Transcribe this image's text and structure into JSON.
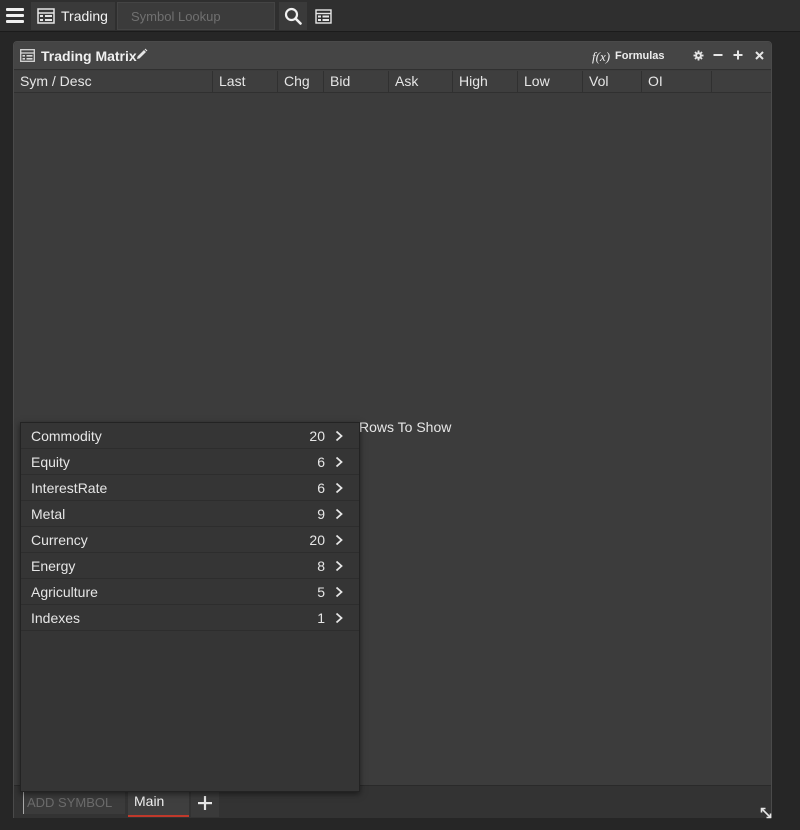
{
  "toolbar": {
    "menu_icon": "hamburger-icon",
    "tab_label": "Trading",
    "tab_icon": "layout-icon",
    "search_placeholder": "Symbol Lookup",
    "search_icon": "search-icon",
    "layout_icon": "layout-icon"
  },
  "panel": {
    "title": "Trading Matrix",
    "title_icon": "layout-icon",
    "edit_icon": "pencil-icon",
    "fx_symbol": "f(x)",
    "formulas_label": "Formulas",
    "controls": [
      "gear-icon",
      "minimize-icon",
      "maximize-icon",
      "close-icon"
    ],
    "columns": [
      "Sym / Desc",
      "Last",
      "Chg",
      "Bid",
      "Ask",
      "High",
      "Low",
      "Vol",
      "OI"
    ],
    "empty_message": "Rows To Show"
  },
  "footer": {
    "add_symbol_placeholder": "ADD SYMBOL",
    "tab_label": "Main",
    "add_tab_icon": "plus-icon",
    "resize_icon": "resize-icon"
  },
  "dropdown": {
    "items": [
      {
        "label": "Commodity",
        "count": "20"
      },
      {
        "label": "Equity",
        "count": "6"
      },
      {
        "label": "InterestRate",
        "count": "6"
      },
      {
        "label": "Metal",
        "count": "9"
      },
      {
        "label": "Currency",
        "count": "20"
      },
      {
        "label": "Energy",
        "count": "8"
      },
      {
        "label": "Agriculture",
        "count": "5"
      },
      {
        "label": "Indexes",
        "count": "1"
      }
    ]
  },
  "colors": {
    "background": "#262626",
    "panel": "#3c3c3c",
    "text": "#e6e6e6",
    "active_tab_underline": "#c0392b"
  }
}
